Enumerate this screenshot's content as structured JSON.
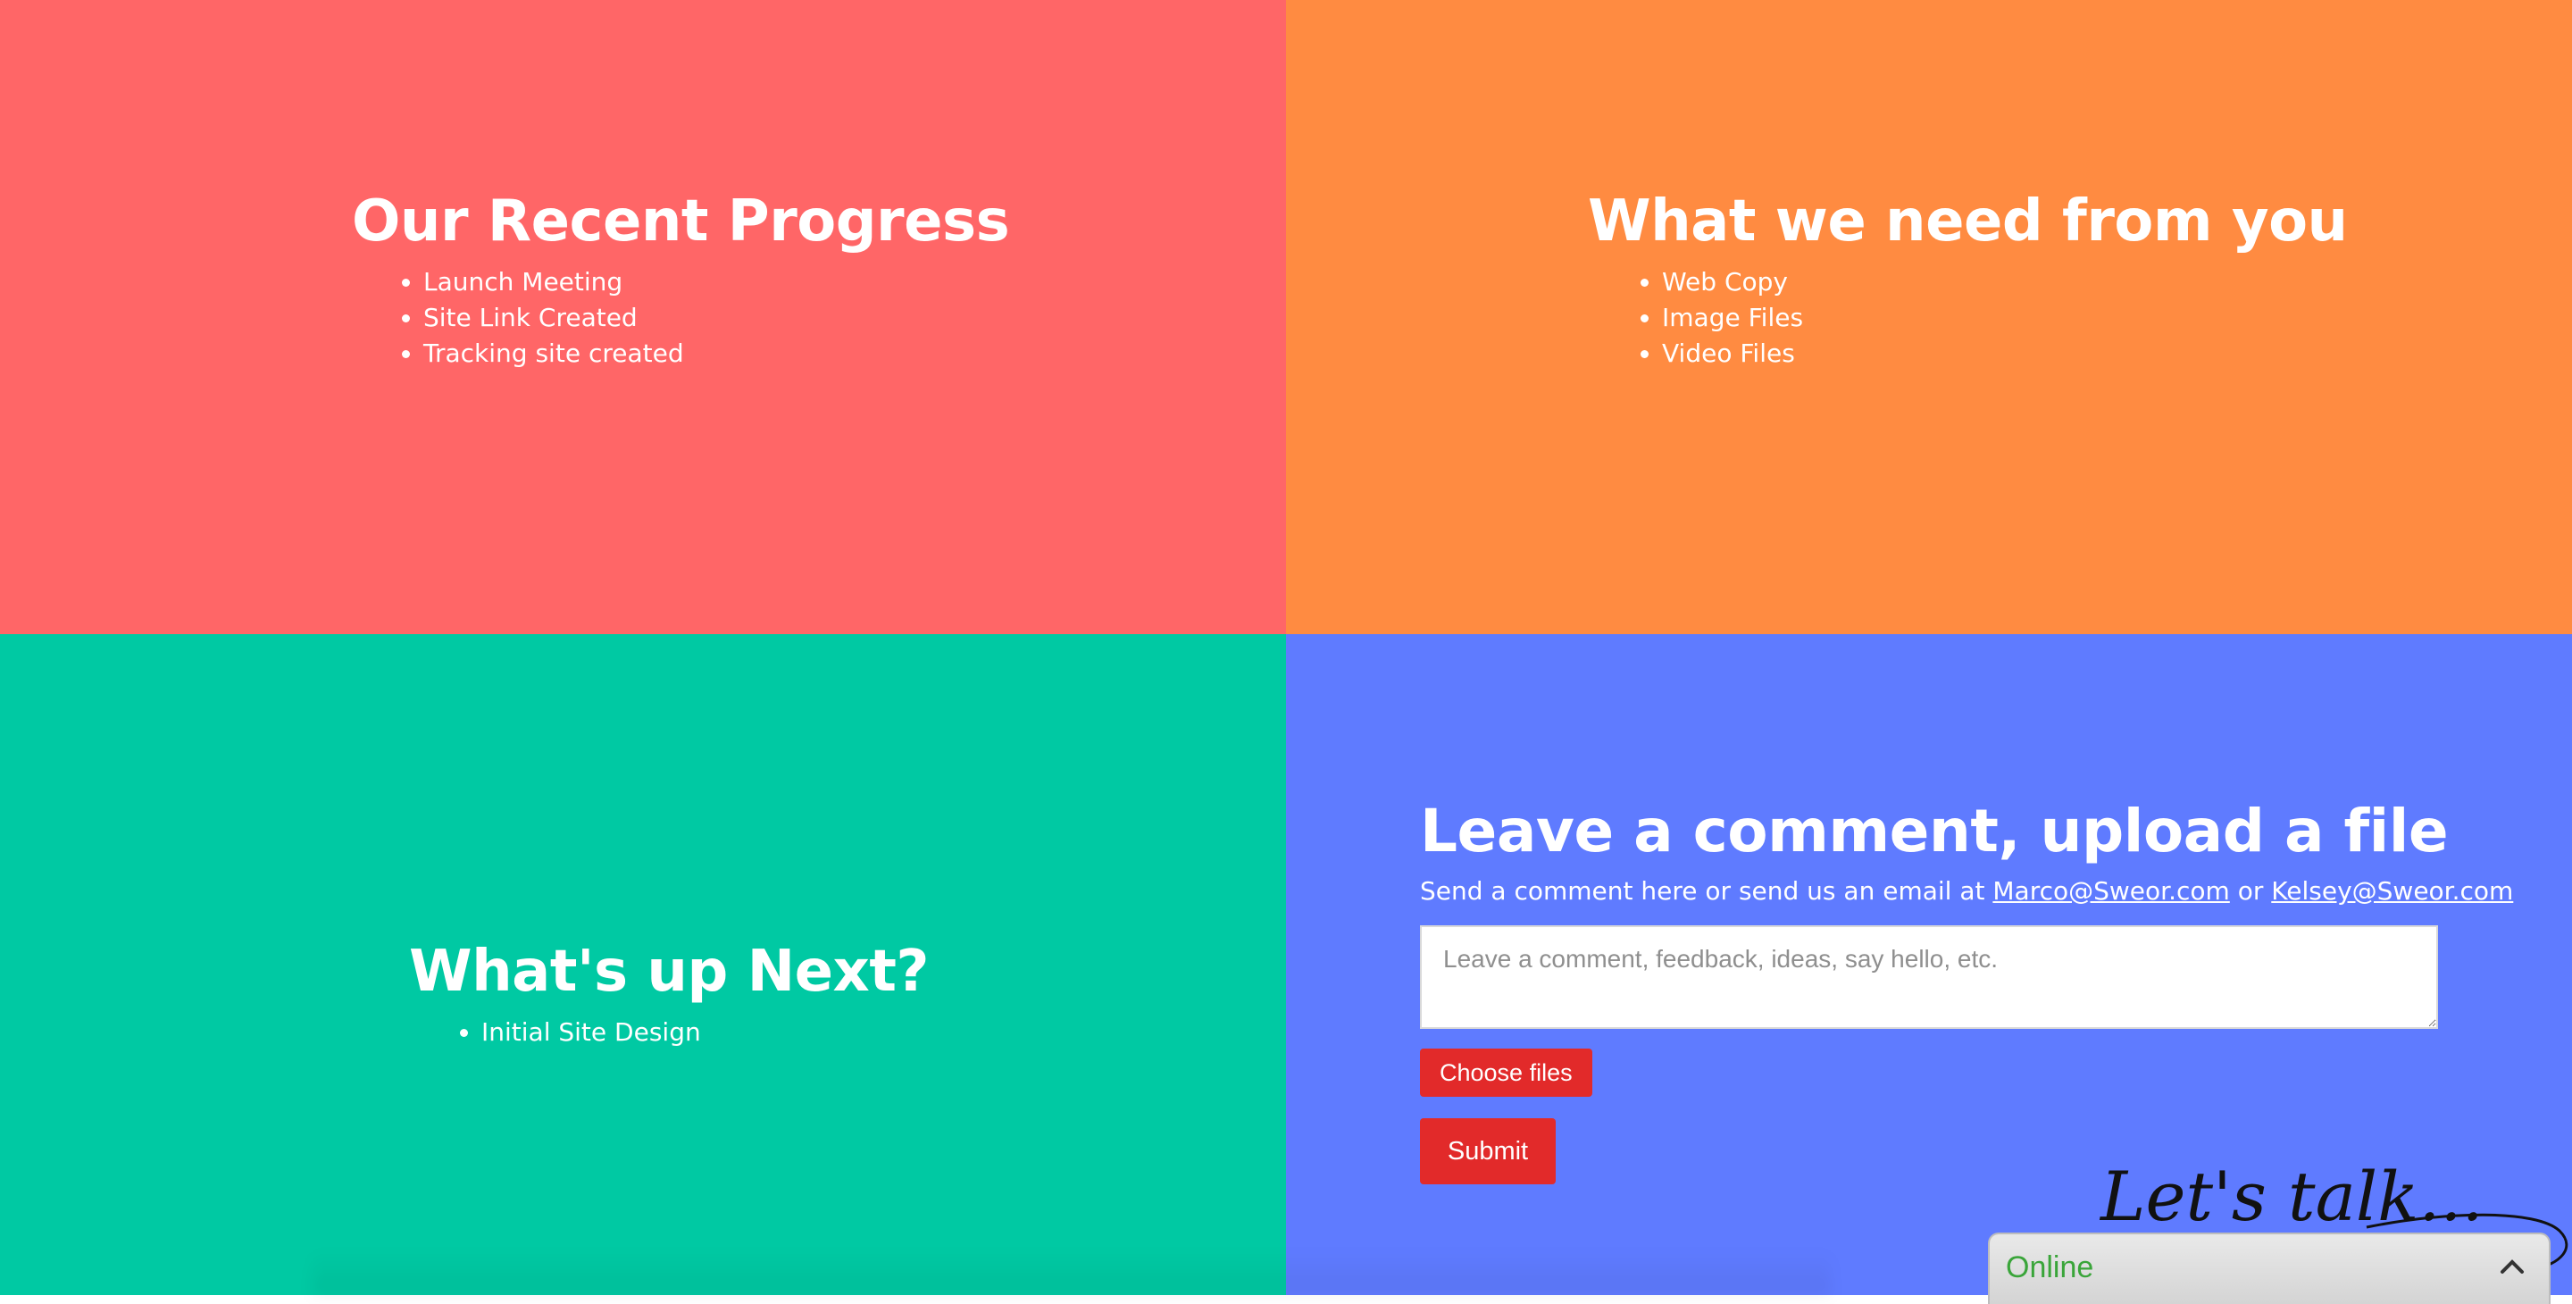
{
  "progress": {
    "title": "Our Recent Progress",
    "items": [
      "Launch Meeting",
      "Site Link Created",
      "Tracking site created"
    ]
  },
  "need": {
    "title": "What we need from you",
    "items": [
      "Web Copy",
      "Image Files",
      "Video Files"
    ]
  },
  "next": {
    "title": "What's up Next?",
    "items": [
      "Initial Site Design"
    ]
  },
  "comment": {
    "title": "Leave a comment, upload a file",
    "send_prefix": "Send a comment here or send us an email at",
    "email_1": "Marco@Sweor.com",
    "or_text": "or",
    "email_2": "Kelsey@Sweor.com",
    "placeholder": "Leave a comment, feedback, ideas, say hello, etc.",
    "choose_files_label": "Choose files",
    "submit_label": "Submit"
  },
  "chat": {
    "lets_talk": "Let's talk...",
    "status": "Online",
    "status_color": "#3aa53a",
    "toggle_icon": "chevron-up-icon"
  },
  "colors": {
    "progress_bg": "#ff6667",
    "need_bg": "#ff8b41",
    "next_bg": "#00c9a3",
    "comment_bg": "#5f7bff",
    "button_red": "#e22a2a"
  }
}
